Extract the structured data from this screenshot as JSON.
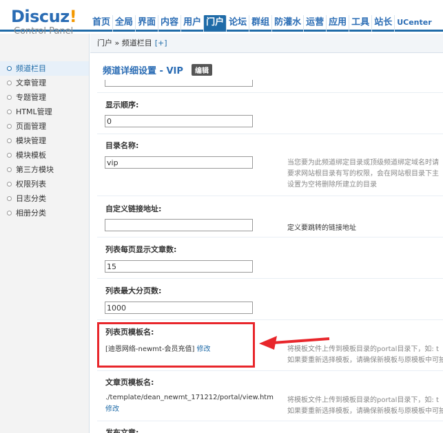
{
  "app": {
    "logo_main": "Discuz",
    "logo_exclaim": "!",
    "logo_sub": "Control Panel"
  },
  "nav": [
    {
      "label": "首页"
    },
    {
      "label": "全局"
    },
    {
      "label": "界面"
    },
    {
      "label": "内容"
    },
    {
      "label": "用户"
    },
    {
      "label": "门户",
      "active": true
    },
    {
      "label": "论坛"
    },
    {
      "label": "群组"
    },
    {
      "label": "防灌水"
    },
    {
      "label": "运营"
    },
    {
      "label": "应用"
    },
    {
      "label": "工具"
    },
    {
      "label": "站长"
    },
    {
      "label": "UCenter"
    }
  ],
  "breadcrumb": {
    "path": "门户 » 频道栏目",
    "add": "[+]"
  },
  "sidebar": {
    "items": [
      {
        "label": "频道栏目",
        "active": true
      },
      {
        "label": "文章管理"
      },
      {
        "label": "专题管理"
      },
      {
        "label": "HTML管理"
      },
      {
        "label": "页面管理"
      },
      {
        "label": "模块管理"
      },
      {
        "label": "模块模板"
      },
      {
        "label": "第三方模块"
      },
      {
        "label": "权限列表"
      },
      {
        "label": "日志分类"
      },
      {
        "label": "相册分类"
      }
    ]
  },
  "main": {
    "title": "频道详细设置 - VIP",
    "edit_badge": "编辑",
    "display_order": {
      "label": "显示顺序:",
      "value": "0"
    },
    "dir_name": {
      "label": "目录名称:",
      "value": "vip",
      "tip_lines": [
        "当您要为此频道绑定目录或顶级频道绑定域名时请",
        "要求网站根目录有写的权限，会在网站根目录下主",
        "设置为空将删除所建立的目录"
      ]
    },
    "custom_link": {
      "label": "自定义链接地址:",
      "value": "",
      "tip": "定义要跳转的链接地址"
    },
    "per_page": {
      "label": "列表每页显示文章数:",
      "value": "15"
    },
    "max_pages": {
      "label": "列表最大分页数:",
      "value": "1000"
    },
    "list_template": {
      "label": "列表页模板名:",
      "value": "[迪恩网络-newmt-会员充值]",
      "edit_link": "修改",
      "tip_lines": [
        "将模板文件上传到模板目录的portal目录下，如: t",
        "如果要重新选择模板，请确保新模板与原模板中可拍"
      ]
    },
    "article_template": {
      "label": "文章页模板名:",
      "value": "./template/dean_newmt_171212/portal/view.htm",
      "edit_link": "修改",
      "tip_lines": [
        "将模板文件上传到模板目录的portal目录下，如: t",
        "如果要重新选择模板，请确保新模板与原模板中可拍"
      ]
    },
    "publish_label": "发布文章:"
  },
  "colors": {
    "brand_blue": "#2a6cb4",
    "nav_active": "#1f6ba8",
    "highlight_red": "#e8262b"
  }
}
